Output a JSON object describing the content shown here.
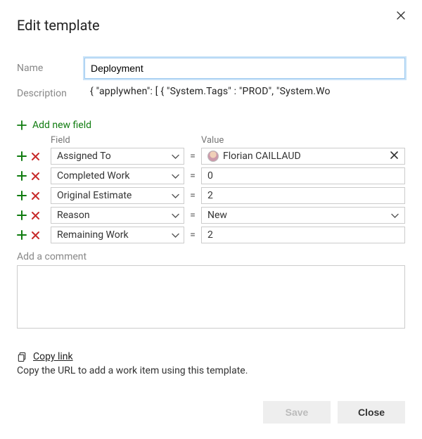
{
  "title": "Edit template",
  "labels": {
    "name": "Name",
    "description": "Description",
    "add_new_field": "Add new field",
    "col_field": "Field",
    "col_value": "Value",
    "comment_placeholder": "Add a comment",
    "copy_link": "Copy link",
    "copy_hint": "Copy the URL to add a work item using this template.",
    "save": "Save",
    "close": "Close",
    "equals": "="
  },
  "form": {
    "name_value": "Deployment",
    "description_value": "{     \"applywhen\": [     {         \"System.Tags\" : \"PROD\",         \"System.Wo"
  },
  "fields": [
    {
      "field": "Assigned To",
      "value": "Florian CAILLAUD",
      "value_type": "person",
      "clearable": true
    },
    {
      "field": "Completed Work",
      "value": "0",
      "value_type": "text",
      "clearable": false
    },
    {
      "field": "Original Estimate",
      "value": "2",
      "value_type": "text",
      "clearable": false
    },
    {
      "field": "Reason",
      "value": "New",
      "value_type": "select",
      "clearable": false
    },
    {
      "field": "Remaining Work",
      "value": "2",
      "value_type": "text",
      "clearable": false
    }
  ]
}
